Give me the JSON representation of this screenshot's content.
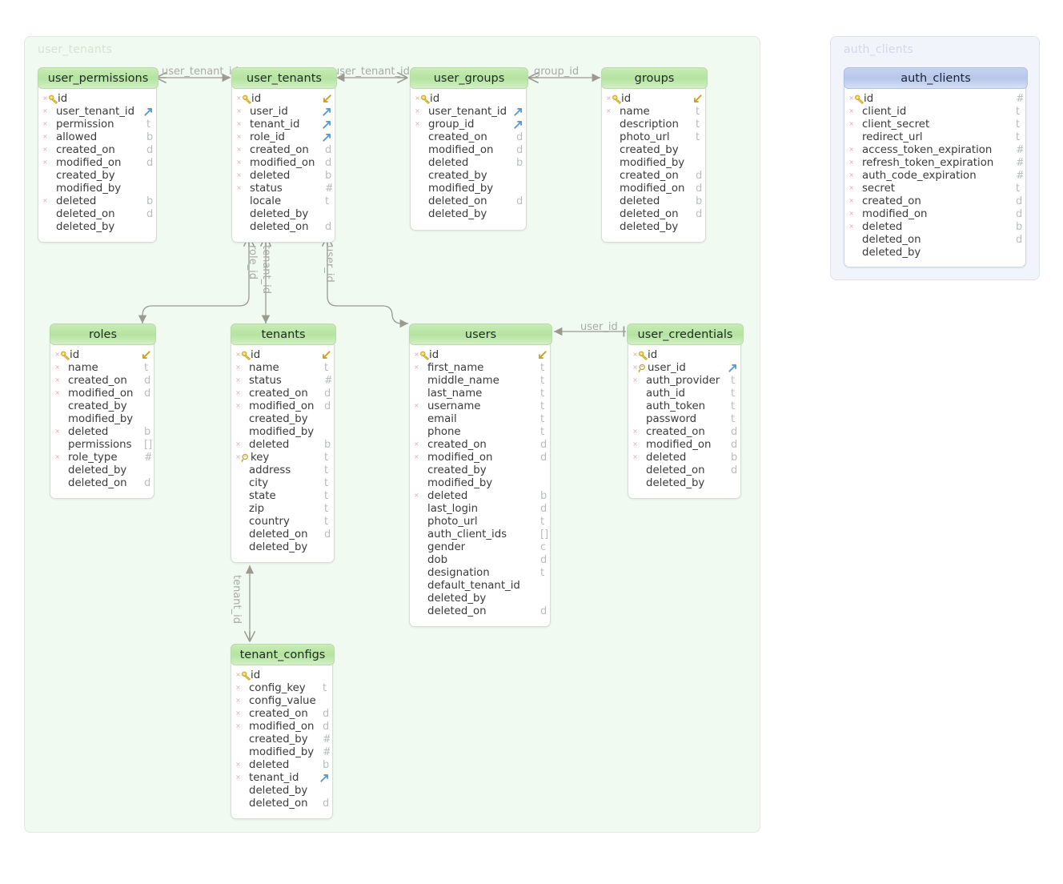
{
  "diagram": {
    "type": "entity-relationship-diagram",
    "schemas": [
      {
        "name": "user_tenants",
        "accent": "#eaf7ea"
      },
      {
        "name": "auth_clients",
        "accent": "#eef1fa"
      }
    ]
  },
  "tables": {
    "user_permissions": {
      "title": "user_permissions",
      "fields": [
        {
          "name": "id",
          "key": "pk",
          "required": true,
          "type": ""
        },
        {
          "name": "user_tenant_id",
          "key": "",
          "required": true,
          "type": "",
          "fk": true
        },
        {
          "name": "permission",
          "key": "",
          "required": true,
          "type": "t"
        },
        {
          "name": "allowed",
          "key": "",
          "required": true,
          "type": "b"
        },
        {
          "name": "created_on",
          "key": "",
          "required": true,
          "type": "d"
        },
        {
          "name": "modified_on",
          "key": "",
          "required": true,
          "type": "d"
        },
        {
          "name": "created_by",
          "key": "",
          "required": false,
          "type": ""
        },
        {
          "name": "modified_by",
          "key": "",
          "required": false,
          "type": ""
        },
        {
          "name": "deleted",
          "key": "",
          "required": true,
          "type": "b"
        },
        {
          "name": "deleted_on",
          "key": "",
          "required": false,
          "type": "d"
        },
        {
          "name": "deleted_by",
          "key": "",
          "required": false,
          "type": ""
        }
      ]
    },
    "user_tenants": {
      "title": "user_tenants",
      "fields": [
        {
          "name": "id",
          "key": "pk",
          "required": true,
          "type": "",
          "fkback": true
        },
        {
          "name": "user_id",
          "key": "",
          "required": true,
          "type": "",
          "fk": true
        },
        {
          "name": "tenant_id",
          "key": "",
          "required": true,
          "type": "",
          "fk": true
        },
        {
          "name": "role_id",
          "key": "",
          "required": true,
          "type": "",
          "fk": true
        },
        {
          "name": "created_on",
          "key": "",
          "required": true,
          "type": "d"
        },
        {
          "name": "modified_on",
          "key": "",
          "required": true,
          "type": "d"
        },
        {
          "name": "deleted",
          "key": "",
          "required": true,
          "type": "b"
        },
        {
          "name": "status",
          "key": "",
          "required": true,
          "type": "#"
        },
        {
          "name": "locale",
          "key": "",
          "required": false,
          "type": "t"
        },
        {
          "name": "deleted_by",
          "key": "",
          "required": false,
          "type": ""
        },
        {
          "name": "deleted_on",
          "key": "",
          "required": false,
          "type": "d"
        }
      ]
    },
    "user_groups": {
      "title": "user_groups",
      "fields": [
        {
          "name": "id",
          "key": "pk",
          "required": true,
          "type": ""
        },
        {
          "name": "user_tenant_id",
          "key": "",
          "required": true,
          "type": "",
          "fk": true
        },
        {
          "name": "group_id",
          "key": "",
          "required": true,
          "type": "",
          "fk": true
        },
        {
          "name": "created_on",
          "key": "",
          "required": false,
          "type": "d"
        },
        {
          "name": "modified_on",
          "key": "",
          "required": false,
          "type": "d"
        },
        {
          "name": "deleted",
          "key": "",
          "required": false,
          "type": "b"
        },
        {
          "name": "created_by",
          "key": "",
          "required": false,
          "type": ""
        },
        {
          "name": "modified_by",
          "key": "",
          "required": false,
          "type": ""
        },
        {
          "name": "deleted_on",
          "key": "",
          "required": false,
          "type": "d"
        },
        {
          "name": "deleted_by",
          "key": "",
          "required": false,
          "type": ""
        }
      ]
    },
    "groups": {
      "title": "groups",
      "fields": [
        {
          "name": "id",
          "key": "pk",
          "required": true,
          "type": "",
          "fkback": true
        },
        {
          "name": "name",
          "key": "",
          "required": true,
          "type": "t"
        },
        {
          "name": "description",
          "key": "",
          "required": false,
          "type": "t"
        },
        {
          "name": "photo_url",
          "key": "",
          "required": false,
          "type": "t"
        },
        {
          "name": "created_by",
          "key": "",
          "required": false,
          "type": ""
        },
        {
          "name": "modified_by",
          "key": "",
          "required": false,
          "type": ""
        },
        {
          "name": "created_on",
          "key": "",
          "required": false,
          "type": "d"
        },
        {
          "name": "modified_on",
          "key": "",
          "required": false,
          "type": "d"
        },
        {
          "name": "deleted",
          "key": "",
          "required": false,
          "type": "b"
        },
        {
          "name": "deleted_on",
          "key": "",
          "required": false,
          "type": "d"
        },
        {
          "name": "deleted_by",
          "key": "",
          "required": false,
          "type": ""
        }
      ]
    },
    "auth_clients": {
      "title": "auth_clients",
      "fields": [
        {
          "name": "id",
          "key": "pk",
          "required": true,
          "type": "#"
        },
        {
          "name": "client_id",
          "key": "",
          "required": true,
          "type": "t"
        },
        {
          "name": "client_secret",
          "key": "",
          "required": true,
          "type": "t"
        },
        {
          "name": "redirect_url",
          "key": "",
          "required": false,
          "type": "t"
        },
        {
          "name": "access_token_expiration",
          "key": "",
          "required": true,
          "type": "#"
        },
        {
          "name": "refresh_token_expiration",
          "key": "",
          "required": true,
          "type": "#"
        },
        {
          "name": "auth_code_expiration",
          "key": "",
          "required": true,
          "type": "#"
        },
        {
          "name": "secret",
          "key": "",
          "required": true,
          "type": "t"
        },
        {
          "name": "created_on",
          "key": "",
          "required": true,
          "type": "d"
        },
        {
          "name": "modified_on",
          "key": "",
          "required": true,
          "type": "d"
        },
        {
          "name": "deleted",
          "key": "",
          "required": true,
          "type": "b"
        },
        {
          "name": "deleted_on",
          "key": "",
          "required": false,
          "type": "d"
        },
        {
          "name": "deleted_by",
          "key": "",
          "required": false,
          "type": ""
        }
      ]
    },
    "roles": {
      "title": "roles",
      "fields": [
        {
          "name": "id",
          "key": "pk",
          "required": true,
          "type": "",
          "fkback": true
        },
        {
          "name": "name",
          "key": "",
          "required": true,
          "type": "t"
        },
        {
          "name": "created_on",
          "key": "",
          "required": true,
          "type": "d"
        },
        {
          "name": "modified_on",
          "key": "",
          "required": true,
          "type": "d"
        },
        {
          "name": "created_by",
          "key": "",
          "required": false,
          "type": ""
        },
        {
          "name": "modified_by",
          "key": "",
          "required": false,
          "type": ""
        },
        {
          "name": "deleted",
          "key": "",
          "required": true,
          "type": "b"
        },
        {
          "name": "permissions",
          "key": "",
          "required": false,
          "type": "[]"
        },
        {
          "name": "role_type",
          "key": "",
          "required": true,
          "type": "#"
        },
        {
          "name": "deleted_by",
          "key": "",
          "required": false,
          "type": ""
        },
        {
          "name": "deleted_on",
          "key": "",
          "required": false,
          "type": "d"
        }
      ]
    },
    "tenants": {
      "title": "tenants",
      "fields": [
        {
          "name": "id",
          "key": "pk",
          "required": true,
          "type": "",
          "fkback": true
        },
        {
          "name": "name",
          "key": "",
          "required": true,
          "type": "t"
        },
        {
          "name": "status",
          "key": "",
          "required": true,
          "type": "#"
        },
        {
          "name": "created_on",
          "key": "",
          "required": true,
          "type": "d"
        },
        {
          "name": "modified_on",
          "key": "",
          "required": true,
          "type": "d"
        },
        {
          "name": "created_by",
          "key": "",
          "required": false,
          "type": ""
        },
        {
          "name": "modified_by",
          "key": "",
          "required": false,
          "type": ""
        },
        {
          "name": "deleted",
          "key": "",
          "required": true,
          "type": "b"
        },
        {
          "name": "key",
          "key": "uk",
          "required": true,
          "type": "t"
        },
        {
          "name": "address",
          "key": "",
          "required": false,
          "type": "t"
        },
        {
          "name": "city",
          "key": "",
          "required": false,
          "type": "t"
        },
        {
          "name": "state",
          "key": "",
          "required": false,
          "type": "t"
        },
        {
          "name": "zip",
          "key": "",
          "required": false,
          "type": "t"
        },
        {
          "name": "country",
          "key": "",
          "required": false,
          "type": "t"
        },
        {
          "name": "deleted_on",
          "key": "",
          "required": false,
          "type": "d"
        },
        {
          "name": "deleted_by",
          "key": "",
          "required": false,
          "type": ""
        }
      ]
    },
    "users": {
      "title": "users",
      "fields": [
        {
          "name": "id",
          "key": "pk",
          "required": true,
          "type": "",
          "fkback": true
        },
        {
          "name": "first_name",
          "key": "",
          "required": true,
          "type": "t"
        },
        {
          "name": "middle_name",
          "key": "",
          "required": false,
          "type": "t"
        },
        {
          "name": "last_name",
          "key": "",
          "required": false,
          "type": "t"
        },
        {
          "name": "username",
          "key": "",
          "required": true,
          "type": "t"
        },
        {
          "name": "email",
          "key": "",
          "required": false,
          "type": "t"
        },
        {
          "name": "phone",
          "key": "",
          "required": false,
          "type": "t"
        },
        {
          "name": "created_on",
          "key": "",
          "required": true,
          "type": "d"
        },
        {
          "name": "modified_on",
          "key": "",
          "required": true,
          "type": "d"
        },
        {
          "name": "created_by",
          "key": "",
          "required": false,
          "type": ""
        },
        {
          "name": "modified_by",
          "key": "",
          "required": false,
          "type": ""
        },
        {
          "name": "deleted",
          "key": "",
          "required": true,
          "type": "b"
        },
        {
          "name": "last_login",
          "key": "",
          "required": false,
          "type": "d"
        },
        {
          "name": "photo_url",
          "key": "",
          "required": false,
          "type": "t"
        },
        {
          "name": "auth_client_ids",
          "key": "",
          "required": false,
          "type": "[]"
        },
        {
          "name": "gender",
          "key": "",
          "required": false,
          "type": "c"
        },
        {
          "name": "dob",
          "key": "",
          "required": false,
          "type": "d"
        },
        {
          "name": "designation",
          "key": "",
          "required": false,
          "type": "t"
        },
        {
          "name": "default_tenant_id",
          "key": "",
          "required": false,
          "type": ""
        },
        {
          "name": "deleted_by",
          "key": "",
          "required": false,
          "type": ""
        },
        {
          "name": "deleted_on",
          "key": "",
          "required": false,
          "type": "d"
        }
      ]
    },
    "user_credentials": {
      "title": "user_credentials",
      "fields": [
        {
          "name": "id",
          "key": "pk",
          "required": true,
          "type": ""
        },
        {
          "name": "user_id",
          "key": "uk",
          "required": true,
          "type": "",
          "fk": true
        },
        {
          "name": "auth_provider",
          "key": "",
          "required": true,
          "type": "t"
        },
        {
          "name": "auth_id",
          "key": "",
          "required": false,
          "type": "t"
        },
        {
          "name": "auth_token",
          "key": "",
          "required": false,
          "type": "t"
        },
        {
          "name": "password",
          "key": "",
          "required": false,
          "type": "t"
        },
        {
          "name": "created_on",
          "key": "",
          "required": true,
          "type": "d"
        },
        {
          "name": "modified_on",
          "key": "",
          "required": true,
          "type": "d"
        },
        {
          "name": "deleted",
          "key": "",
          "required": true,
          "type": "b"
        },
        {
          "name": "deleted_on",
          "key": "",
          "required": false,
          "type": "d"
        },
        {
          "name": "deleted_by",
          "key": "",
          "required": false,
          "type": ""
        }
      ]
    },
    "tenant_configs": {
      "title": "tenant_configs",
      "fields": [
        {
          "name": "id",
          "key": "pk",
          "required": true,
          "type": ""
        },
        {
          "name": "config_key",
          "key": "",
          "required": true,
          "type": "t"
        },
        {
          "name": "config_value",
          "key": "",
          "required": true,
          "type": ""
        },
        {
          "name": "created_on",
          "key": "",
          "required": true,
          "type": "d"
        },
        {
          "name": "modified_on",
          "key": "",
          "required": true,
          "type": "d"
        },
        {
          "name": "created_by",
          "key": "",
          "required": false,
          "type": "#"
        },
        {
          "name": "modified_by",
          "key": "",
          "required": false,
          "type": "#"
        },
        {
          "name": "deleted",
          "key": "",
          "required": true,
          "type": "b"
        },
        {
          "name": "tenant_id",
          "key": "",
          "required": true,
          "type": "",
          "fk": true
        },
        {
          "name": "deleted_by",
          "key": "",
          "required": false,
          "type": ""
        },
        {
          "name": "deleted_on",
          "key": "",
          "required": false,
          "type": "d"
        }
      ]
    }
  },
  "relations": [
    {
      "id": "rel-user-permissions-user-tenants",
      "label": "user_tenant_id"
    },
    {
      "id": "rel-user-groups-user-tenants",
      "label": "user_tenant_id"
    },
    {
      "id": "rel-user-groups-groups",
      "label": "group_id"
    },
    {
      "id": "rel-user-tenants-roles",
      "label": "role_id"
    },
    {
      "id": "rel-user-tenants-tenants",
      "label": "tenant_id"
    },
    {
      "id": "rel-user-tenants-users",
      "label": "user_id"
    },
    {
      "id": "rel-user-credentials-users",
      "label": "user_id"
    },
    {
      "id": "rel-tenant-configs-tenants",
      "label": "tenant_id"
    }
  ]
}
